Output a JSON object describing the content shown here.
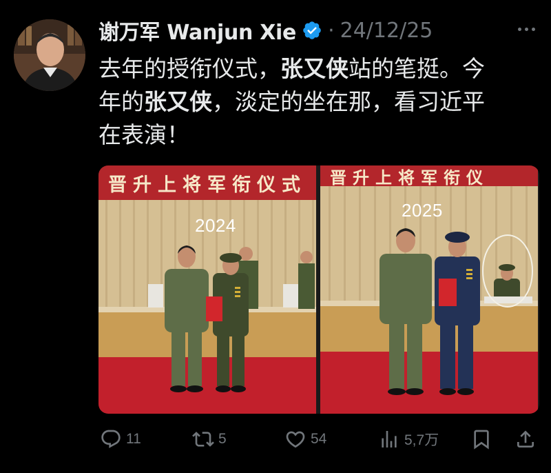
{
  "tweet": {
    "author_name": "谢万军 Wanjun Xie",
    "separator": "·",
    "date": "24/12/25",
    "text": {
      "line1_a": "去年的授衔仪式，",
      "line1_b": "张又侠",
      "line1_c": "站的笔挺。今",
      "line2_a": "年的",
      "line2_b": "张又侠",
      "line2_c": "，淡定的坐在那，看习近平",
      "line3": "在表演！"
    }
  },
  "media": {
    "left": {
      "banner": "晋升上将军衔仪式",
      "year": "2024"
    },
    "right": {
      "banner": "晋升上将军衔仪",
      "year": "2025"
    }
  },
  "actions": {
    "replies": "11",
    "reposts": "5",
    "likes": "54",
    "views": "5,7万"
  },
  "colors": {
    "background": "#000000",
    "text": "#e7e9ea",
    "muted": "#71767b",
    "verified": "#1d9bf0",
    "banner_red": "#b3262b",
    "carpet_red": "#c2202c"
  }
}
